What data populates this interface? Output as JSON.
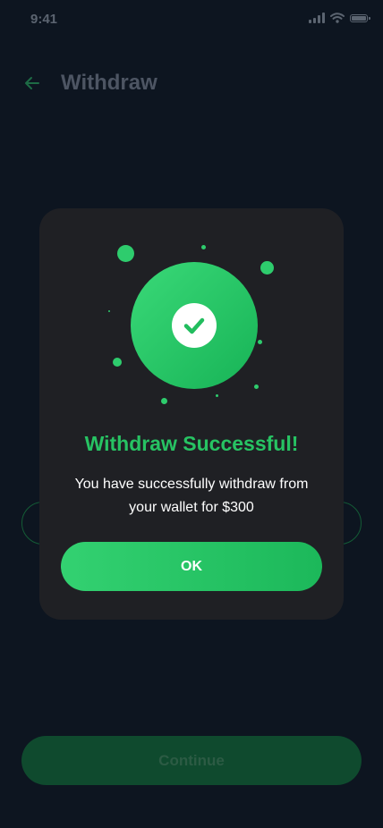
{
  "status_bar": {
    "time": "9:41",
    "icons": [
      "cellular-signal-icon",
      "wifi-icon",
      "battery-icon"
    ]
  },
  "header": {
    "back_icon": "arrow-left-icon",
    "title": "Withdraw"
  },
  "footer": {
    "continue_label": "Continue"
  },
  "modal": {
    "illustration_icon": "checkmark-icon",
    "title": "Withdraw Successful!",
    "message": "You have successfully withdraw from your wallet for $300",
    "ok_label": "OK"
  },
  "colors": {
    "background": "#0d1520",
    "modal_background": "#1f2024",
    "accent_green": "#27c363",
    "muted_text": "#4d5563",
    "disabled_button": "#0f4a2e"
  }
}
